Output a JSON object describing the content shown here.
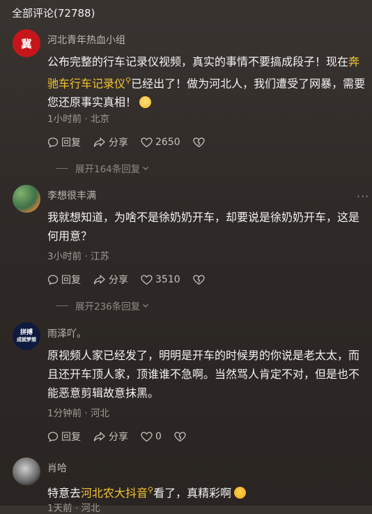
{
  "header": {
    "title": "全部评论(72788)"
  },
  "comments": [
    {
      "avatar": {
        "text": "冀",
        "sub": "青年",
        "tiny": "河北青年热血小组"
      },
      "username": "河北青年热血小组",
      "text_a": "公布完整的行车记录仪视频，真实的事情不要搞成段子！现在",
      "text_hl": "奔驰车行车记录仪",
      "text_b": "已经出了！做为河北人，我们遭受了网暴，需要您还原事实真相！",
      "meta": "1小时前 · 北京",
      "reply_label": "回复",
      "share_label": "分享",
      "likes": "2650",
      "expand_label": "展开164条回复"
    },
    {
      "username": "李想很丰满",
      "text": "我就想知道，为啥不是徐奶奶开车，却要说是徐奶奶开车，这是何用意？",
      "meta": "3小时前 · 江苏",
      "reply_label": "回复",
      "share_label": "分享",
      "likes": "3510",
      "expand_label": "展开236条回复"
    },
    {
      "avatar": {
        "text1": "拼搏",
        "text2": "成就梦想"
      },
      "username": "雨泽吖。",
      "text": "原视频人家已经发了，明明是开车的时候男的你说是老太太，而且还开车顶人家，顶谁谁不急啊。当然骂人肯定不对，但是也不能恶意剪辑故意抹黑。",
      "meta": "1分钟前 · 河北",
      "reply_label": "回复",
      "share_label": "分享",
      "likes": "0"
    },
    {
      "username": "肖哈",
      "text_a": "特意去",
      "text_hl": "河北农大抖音",
      "text_b": "看了，真精彩啊",
      "meta": "1天前 · 河北"
    }
  ],
  "colors": {
    "accent": "#f4c430",
    "background": "#2e2926",
    "avatar_red": "#c7161b"
  }
}
